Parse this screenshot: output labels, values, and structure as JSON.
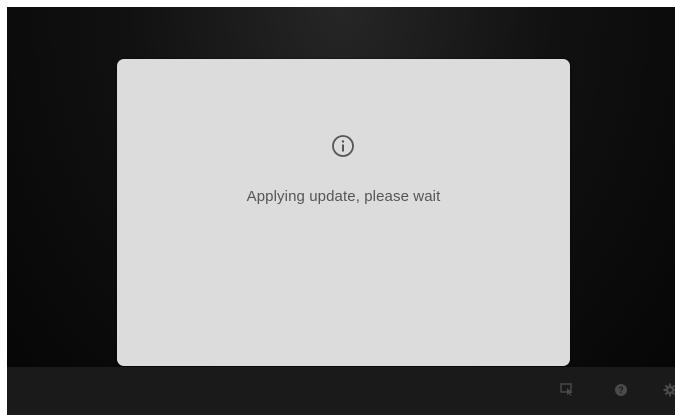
{
  "dialog": {
    "icon": "info-icon",
    "message": "Applying update, please wait"
  },
  "taskbar": {
    "icons": [
      "screen-tap-icon",
      "help-icon",
      "settings-icon"
    ]
  },
  "colors": {
    "background": "#0d0d0d",
    "dialog": "#dcdcdc",
    "text": "#555555",
    "taskbar": "#1a1a1a",
    "tray_icon": "#4a4a4a"
  }
}
